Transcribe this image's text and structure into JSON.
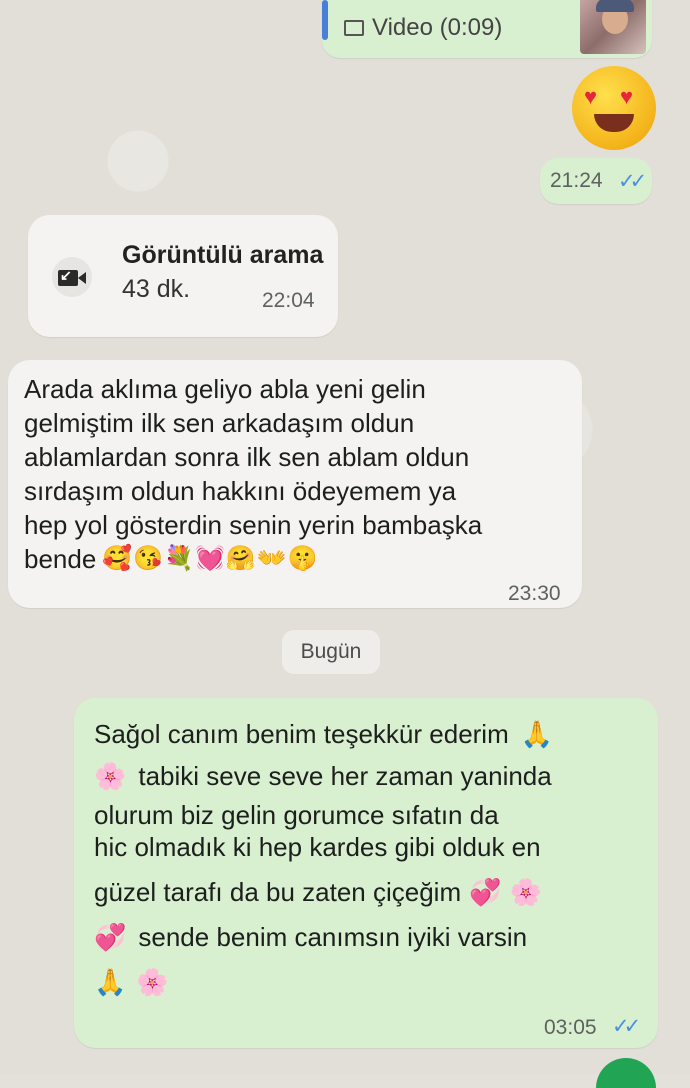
{
  "video_message": {
    "label": "Video (0:09)"
  },
  "emoji_message": {
    "emoji": "😍",
    "time": "21:24"
  },
  "call_message": {
    "title": "Görüntülü arama",
    "duration": "43 dk.",
    "time": "22:04"
  },
  "incoming_message": {
    "lines": [
      "Arada aklıma geliyo abla yeni gelin",
      "gelmiştim ilk sen arkadaşım oldun",
      "ablamlardan sonra ilk sen ablam oldun",
      "sırdaşım oldun hakkını ödeyemem ya",
      "hep yol gösterdin senin yerin bambaşka",
      "bende"
    ],
    "emojis": "🥰😘💐💓🤗👐🤫",
    "time": "23:30"
  },
  "date_separator": "Bugün",
  "outgoing_message": {
    "line1": "Sağol canım benim teşekkür ederim",
    "line2": "tabiki seve seve her zaman yaninda",
    "line3": "olurum  biz gelin gorumce sıfatın da",
    "line4": "hic olmadık ki hep kardes gibi olduk en",
    "line5": "güzel tarafı da bu zaten  çiçeğim",
    "line6": "sende benim canımsın iyiki varsin",
    "emoji_pray": "🙏",
    "emoji_flower": "🌸",
    "emoji_heart": "💞",
    "time": "03:05"
  },
  "colors": {
    "outgoing_bubble": "#d8f0cf",
    "incoming_bubble": "#f4f3f1",
    "read_ticks": "#4c8fde"
  }
}
